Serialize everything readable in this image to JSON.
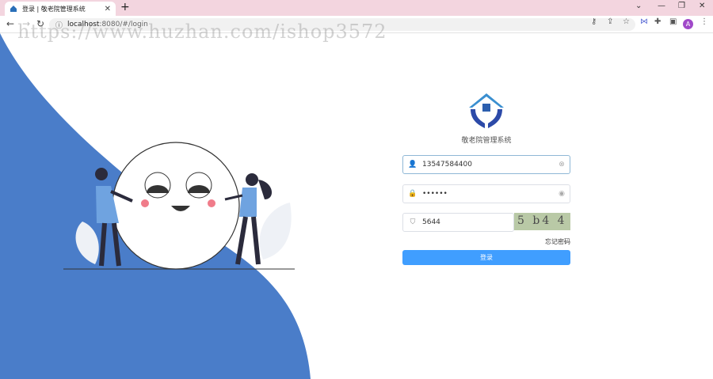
{
  "browser": {
    "tab_title": "登录 | 敬老院管理系统",
    "url_host": "localhost",
    "url_rest": ":8080/#/login",
    "avatar_letter": "A"
  },
  "watermark": "https://www.huzhan.com/ishop3572",
  "login": {
    "system_title": "敬老院管理系统",
    "username_value": "13547584400",
    "password_value": "••••••",
    "captcha_input_value": "5644",
    "captcha_text": "5 b4 4",
    "forgot_label": "忘记密码",
    "submit_label": "登录"
  },
  "colors": {
    "accent": "#409eff",
    "wave": "#4a7dc9",
    "tabbar": "#f3d5df"
  }
}
